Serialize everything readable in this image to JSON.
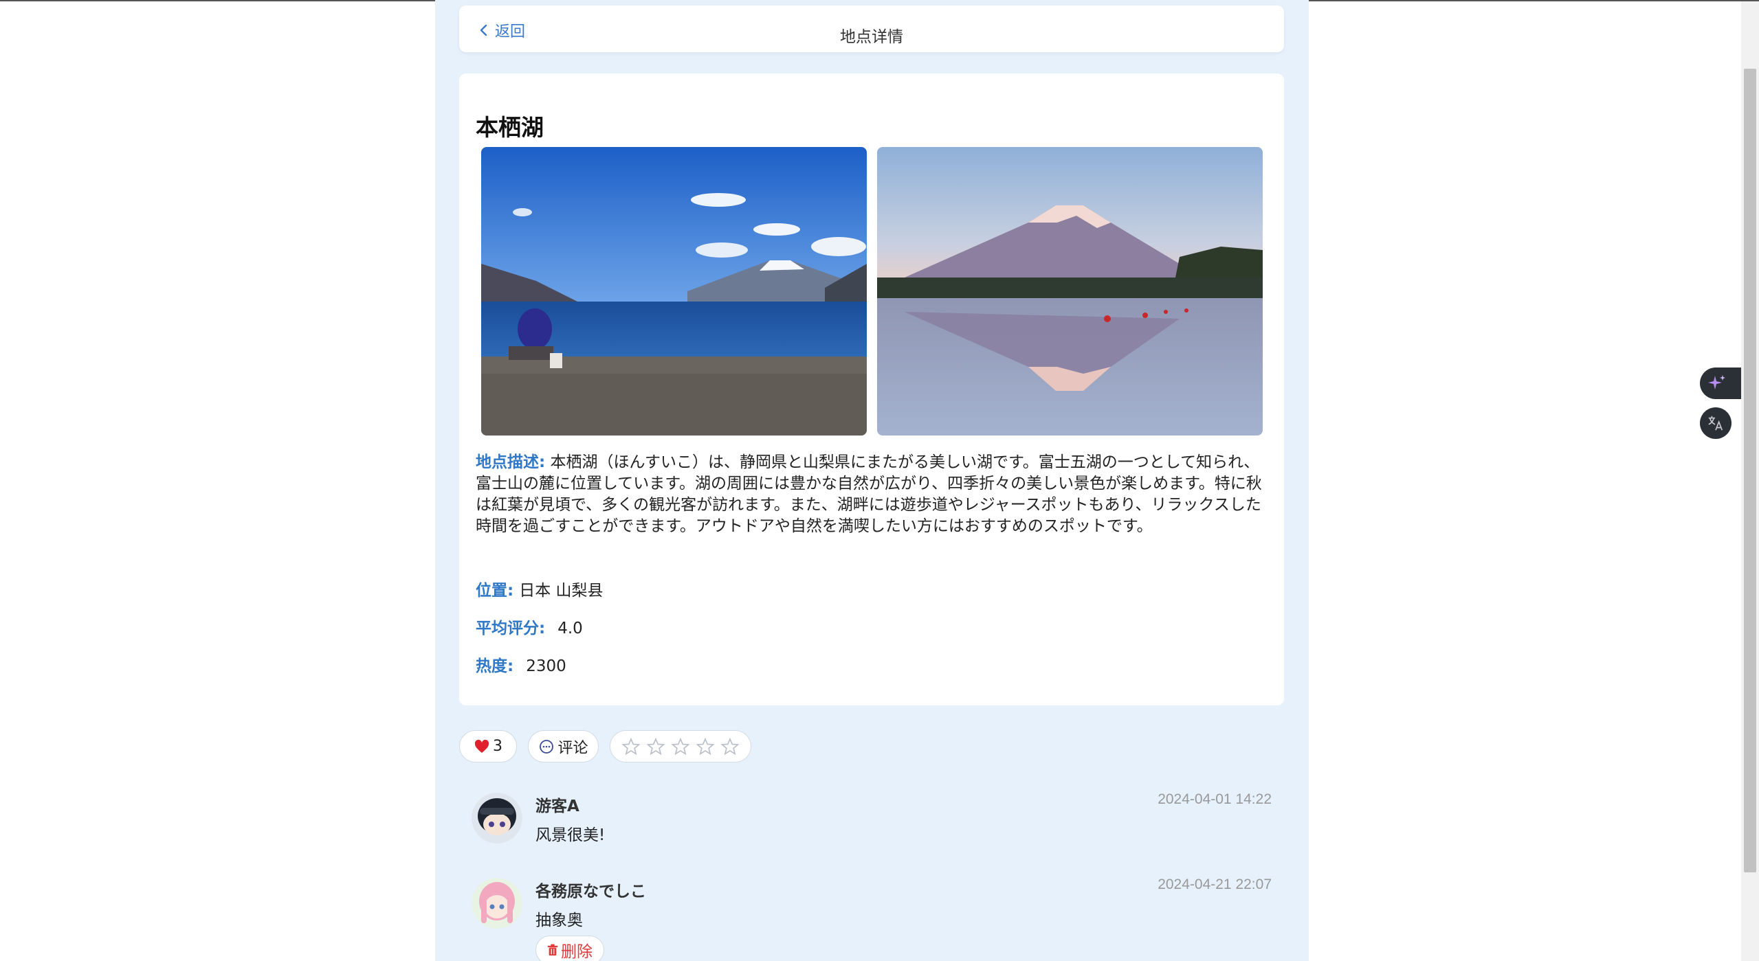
{
  "header": {
    "back_label": "返回",
    "title": "地点详情"
  },
  "place": {
    "name": "本栖湖",
    "description_label": "地点描述:",
    "description": "本栖湖（ほんすいこ）は、静岡県と山梨県にまたがる美しい湖です。富士五湖の一つとして知られ、富士山の麓に位置しています。湖の周囲には豊かな自然が広がり、四季折々の美しい景色が楽しめます。特に秋は紅葉が見頃で、多くの観光客が訪れます。また、湖畔には遊歩道やレジャースポットもあり、リラックスした時間を過ごすことができます。アウトドアや自然を満喫したい方にはおすすめのスポットです。",
    "location_label": "位置:",
    "location": "日本 山梨县",
    "rating_label": "平均评分:",
    "rating": "4.0",
    "heat_label": "热度:",
    "heat": "2300"
  },
  "actions": {
    "like_count": "3",
    "comment_label": "评论",
    "star_count": 5,
    "stars_selected": 0
  },
  "comments": [
    {
      "author": "游客A",
      "time": "2024-04-01 14:22",
      "text": "风景很美!",
      "deletable": false
    },
    {
      "author": "各務原なでしこ",
      "time": "2024-04-21 22:07",
      "text": "抽象奥",
      "deletable": true,
      "delete_label": "删除"
    }
  ],
  "colors": {
    "accent": "#2f78c8",
    "page_bg": "#e6f1fc",
    "like": "#e0202c",
    "delete": "#e03a3a"
  }
}
